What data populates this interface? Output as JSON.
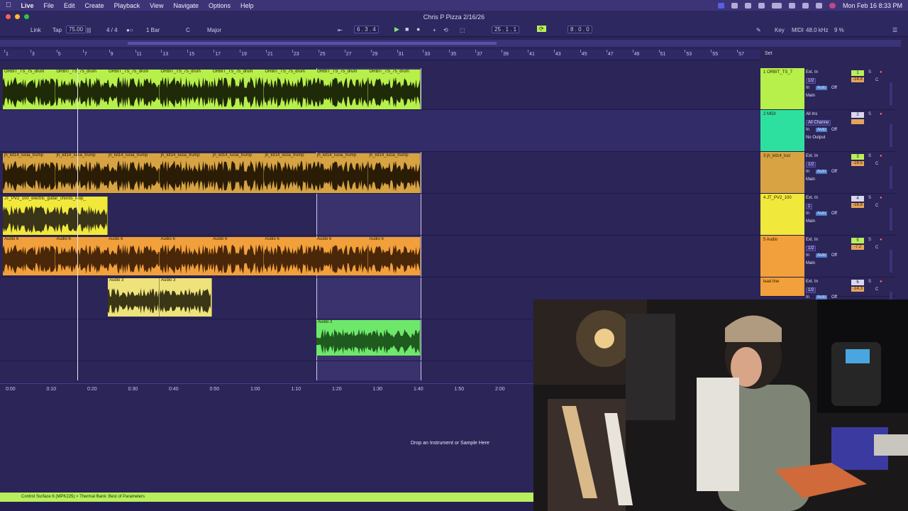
{
  "menubar": {
    "apple": "",
    "items": [
      "Live",
      "File",
      "Edit",
      "Create",
      "Playback",
      "View",
      "Navigate",
      "Options",
      "Help"
    ],
    "clock": "Mon Feb 16  8:33 PM"
  },
  "window": {
    "title": "Chris P Pizza 2/16/26"
  },
  "transport": {
    "link": "Link",
    "tap": "Tap",
    "tempo": "75.00",
    "signature": "4 / 4",
    "quant": "1 Bar",
    "key": "C",
    "scale": "Major",
    "position": "6 .  3 .  4",
    "loop_start": "25 .  1 .  1",
    "punch": "8 .  0 .  0",
    "key_label": "Key",
    "midi_label": "MIDI",
    "sample_rate": "48.0 kHz",
    "cpu": "9 %"
  },
  "ruler": {
    "bars": [
      "1",
      "3",
      "5",
      "7",
      "9",
      "11",
      "13",
      "15",
      "17",
      "19",
      "21",
      "23",
      "25",
      "27",
      "29",
      "31",
      "33",
      "35",
      "37",
      "39",
      "41",
      "43",
      "45",
      "47",
      "49",
      "51",
      "53",
      "55",
      "57"
    ],
    "set_label": "Set"
  },
  "clips": {
    "drum": [
      "ORBIT_TS_75_drum",
      "ORBIT_TS_75_drum",
      "ORBIT_TS_75_drum",
      "ORBIT_TS_75_drum",
      "ORBIT_TS_75_drum",
      "ORBIT_TS_75_drum",
      "ORBIT_TS_75_drum",
      "ORBIT_TS_75_drum"
    ],
    "trumpet": [
      "jh_kit14_lucia_trump",
      "jh_kit14_lucia_trump",
      "jh_kit14_lucia_trump",
      "jh_kit14_lucia_trump",
      "jh_kit14_lucia_trump",
      "jh_kit14_lucia_trump",
      "jh_kit14_lucia_trump",
      "jh_kit14_lucia_trump"
    ],
    "guitar": "JT_PV2_100_electric_guitar_chords_loop_",
    "audio6": [
      "Audio 6",
      "Audio 6",
      "Audio 6",
      "Audio 6",
      "Audio 6",
      "Audio 6",
      "Audio 6",
      "Audio 6"
    ],
    "audio3": [
      "Audio 3",
      "Audio 3"
    ],
    "audio3b": "Audio 3"
  },
  "tracks": [
    {
      "name": "1 ORBIT_TS_7",
      "input": "Ext. In",
      "ch": "1/2",
      "out": "Main",
      "num": "1",
      "vol": "-14.8",
      "pan": "C",
      "monitor": [
        "In",
        "Auto",
        "Off"
      ],
      "color": "#b7ef4b"
    },
    {
      "name": "2 MIDI",
      "input": "All Ins",
      "ch": "All Channe",
      "out": "No Output",
      "num": "2",
      "vol": "",
      "pan": "",
      "monitor": [
        "In",
        "Auto",
        "Off"
      ],
      "color": "#2de0a0"
    },
    {
      "name": "3 jh_kit14_luci",
      "input": "Ext. In",
      "ch": "1/2",
      "out": "Main",
      "num": "3",
      "vol": "-18.5",
      "pan": "C",
      "monitor": [
        "In",
        "Auto",
        "Off"
      ],
      "color": "#d7a343"
    },
    {
      "name": "4 JT_PV2_100",
      "input": "Ext. In",
      "ch": "1",
      "out": "Main",
      "num": "4",
      "vol": "-16.8",
      "pan": "C",
      "monitor": [
        "In",
        "Auto",
        "Off"
      ],
      "color": "#f0e83a"
    },
    {
      "name": "5 Audio",
      "input": "Ext. In",
      "ch": "1/2",
      "out": "Main",
      "num": "5",
      "vol": "-7.2",
      "pan": "C",
      "monitor": [
        "In",
        "Auto",
        "Off"
      ],
      "color": "#f2a03b"
    },
    {
      "name": "lead line",
      "input": "Ext. In",
      "ch": "1/2",
      "out": "",
      "num": "6",
      "vol": "-14.3",
      "pan": "C",
      "monitor": [
        "In",
        "Auto",
        "Off"
      ],
      "color": "#f2a03b"
    }
  ],
  "timeline": [
    "0:00",
    "0:10",
    "0:20",
    "0:30",
    "0:40",
    "0:50",
    "1:00",
    "1:10",
    "1:20",
    "1:30",
    "1:40",
    "1:50",
    "2:00"
  ],
  "device": {
    "drop_hint": "Drop an Instrument or Sample Here"
  },
  "status": {
    "text": "Control Surface 6 (MPK225) > Thermal Bank: Best of Parameters"
  }
}
